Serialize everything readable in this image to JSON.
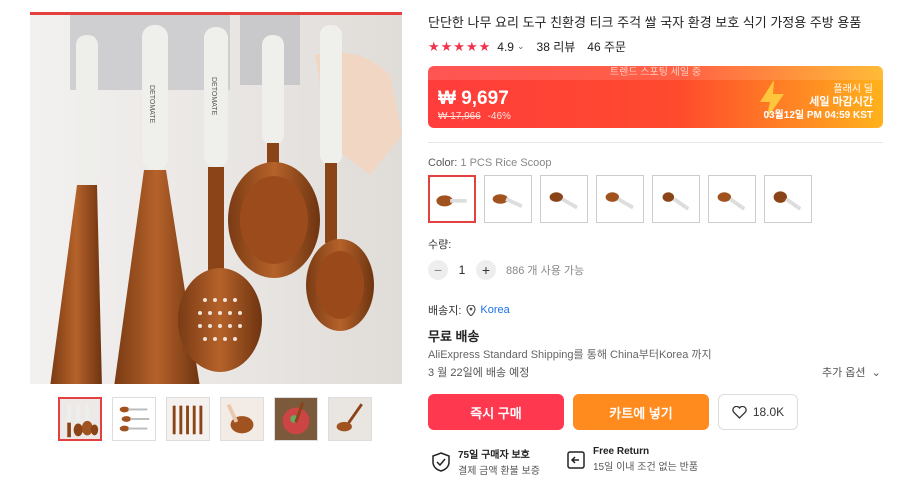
{
  "product": {
    "title": "단단한 나무 요리 도구 친환경 티크 주걱 쌀 국자 환경 보호 식기 가정용 주방 용품",
    "stars": "★★★★★",
    "rating": "4.9",
    "reviews": "38 리뷰",
    "orders": "46 주문",
    "brand": "DETOMATE"
  },
  "price": {
    "sale_label": "트렌드 스포팅 세일 중",
    "current": "₩ 9,697",
    "original": "₩ 17,966",
    "discount": "-46%",
    "flash_title": "플래시 딜",
    "flash_sub": "세일 마감시간",
    "flash_time": "03월12일 PM 04:59 KST"
  },
  "color": {
    "label": "Color:",
    "value": "1 PCS Rice Scoop"
  },
  "quantity": {
    "label": "수량:",
    "value": "1",
    "minus": "−",
    "plus": "+",
    "available": "886 개 사용 가능"
  },
  "shipping": {
    "ship_to_label": "배송지:",
    "country": "Korea",
    "free": "무료 배송",
    "method": "AliExpress Standard Shipping를 통해 China부터Korea 까지",
    "delivery": "3 월 22일에 배송 예정",
    "more_options": "추가 옵션"
  },
  "actions": {
    "buy_now": "즉시 구매",
    "add_to_cart": "카트에 넣기",
    "wishlist_count": "18.0K"
  },
  "guarantees": {
    "protection_title": "75일 구매자 보호",
    "protection_sub": "결제 금액 환불 보증",
    "return_title": "Free Return",
    "return_sub": "15일 이내 조건 없는 반품"
  },
  "colors": {
    "accent": "#fd384f",
    "cart": "#ff8a1e",
    "link": "#1a73e8"
  }
}
